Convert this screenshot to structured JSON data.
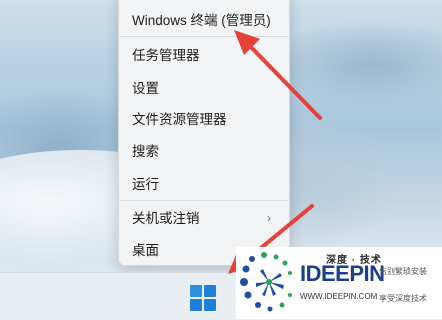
{
  "context_menu": {
    "items": [
      {
        "label": "Windows 终端 (管理员)"
      },
      {
        "label": "任务管理器"
      },
      {
        "label": "设置"
      },
      {
        "label": "文件资源管理器"
      },
      {
        "label": "搜索"
      },
      {
        "label": "运行"
      },
      {
        "label": "关机或注销",
        "chevron": "›"
      },
      {
        "label": "桌面"
      }
    ]
  },
  "taskbar": {
    "start_icon": "windows-start-icon"
  },
  "annotations": {
    "arrow_color": "#e8413a"
  },
  "watermark": {
    "brand_cn": "深度 · 技术",
    "brand": "IDEEPIN",
    "tagline_1": "告别繁琐安装",
    "tagline_2": "享受深度技术",
    "url": "WWW.IDEEPIN.COM"
  }
}
